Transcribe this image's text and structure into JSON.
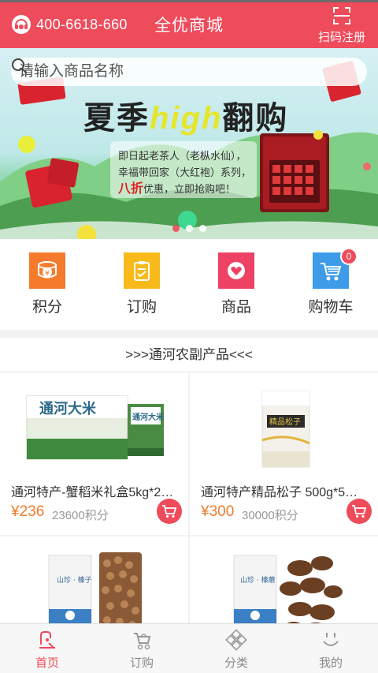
{
  "header": {
    "hotline": "400-6618-660",
    "title": "全优商城",
    "scan_label": "扫码注册"
  },
  "search": {
    "placeholder": "请输入商品名称"
  },
  "banner": {
    "title_part1": "夏季",
    "title_highlight": "high",
    "title_part2": "翻购",
    "line1": "即日起老茶人（老枞水仙），",
    "line2": "幸福带回家（大红袍）系列，",
    "discount": "八折",
    "line3_rest": "优惠，立即抢购吧！",
    "slide_count": 3,
    "active_slide": 1
  },
  "quicknav": [
    {
      "label": "积分",
      "icon": "points-coin-icon",
      "color": "#f47b2c"
    },
    {
      "label": "订购",
      "icon": "order-clipboard-icon",
      "color": "#f8b91a"
    },
    {
      "label": "商品",
      "icon": "product-heart-icon",
      "color": "#ee4264"
    },
    {
      "label": "购物车",
      "icon": "shopping-cart-icon",
      "color": "#3d9be9",
      "badge": "0"
    }
  ],
  "section": {
    "title": ">>>通河农副产品<<<"
  },
  "products": [
    {
      "name": "通河特产-蟹稻米礼盒5kg*2…",
      "price": "¥236",
      "points": "23600积分",
      "image": "rice-gift-box"
    },
    {
      "name": "通河特产精品松子 500g*5…",
      "price": "¥300",
      "points": "30000积分",
      "image": "pine-nut-box"
    },
    {
      "name": "",
      "price": "",
      "points": "",
      "image": "hazelnut-pack"
    },
    {
      "name": "",
      "price": "",
      "points": "",
      "image": "mushroom-pack"
    }
  ],
  "tabbar": [
    {
      "label": "首页",
      "icon": "home-icon",
      "active": true
    },
    {
      "label": "订购",
      "icon": "stroller-cart-icon",
      "active": false
    },
    {
      "label": "分类",
      "icon": "category-diamond-icon",
      "active": false
    },
    {
      "label": "我的",
      "icon": "smile-face-icon",
      "active": false
    }
  ],
  "colors": {
    "brand": "#ee4b5b",
    "price": "#f07a2a"
  }
}
